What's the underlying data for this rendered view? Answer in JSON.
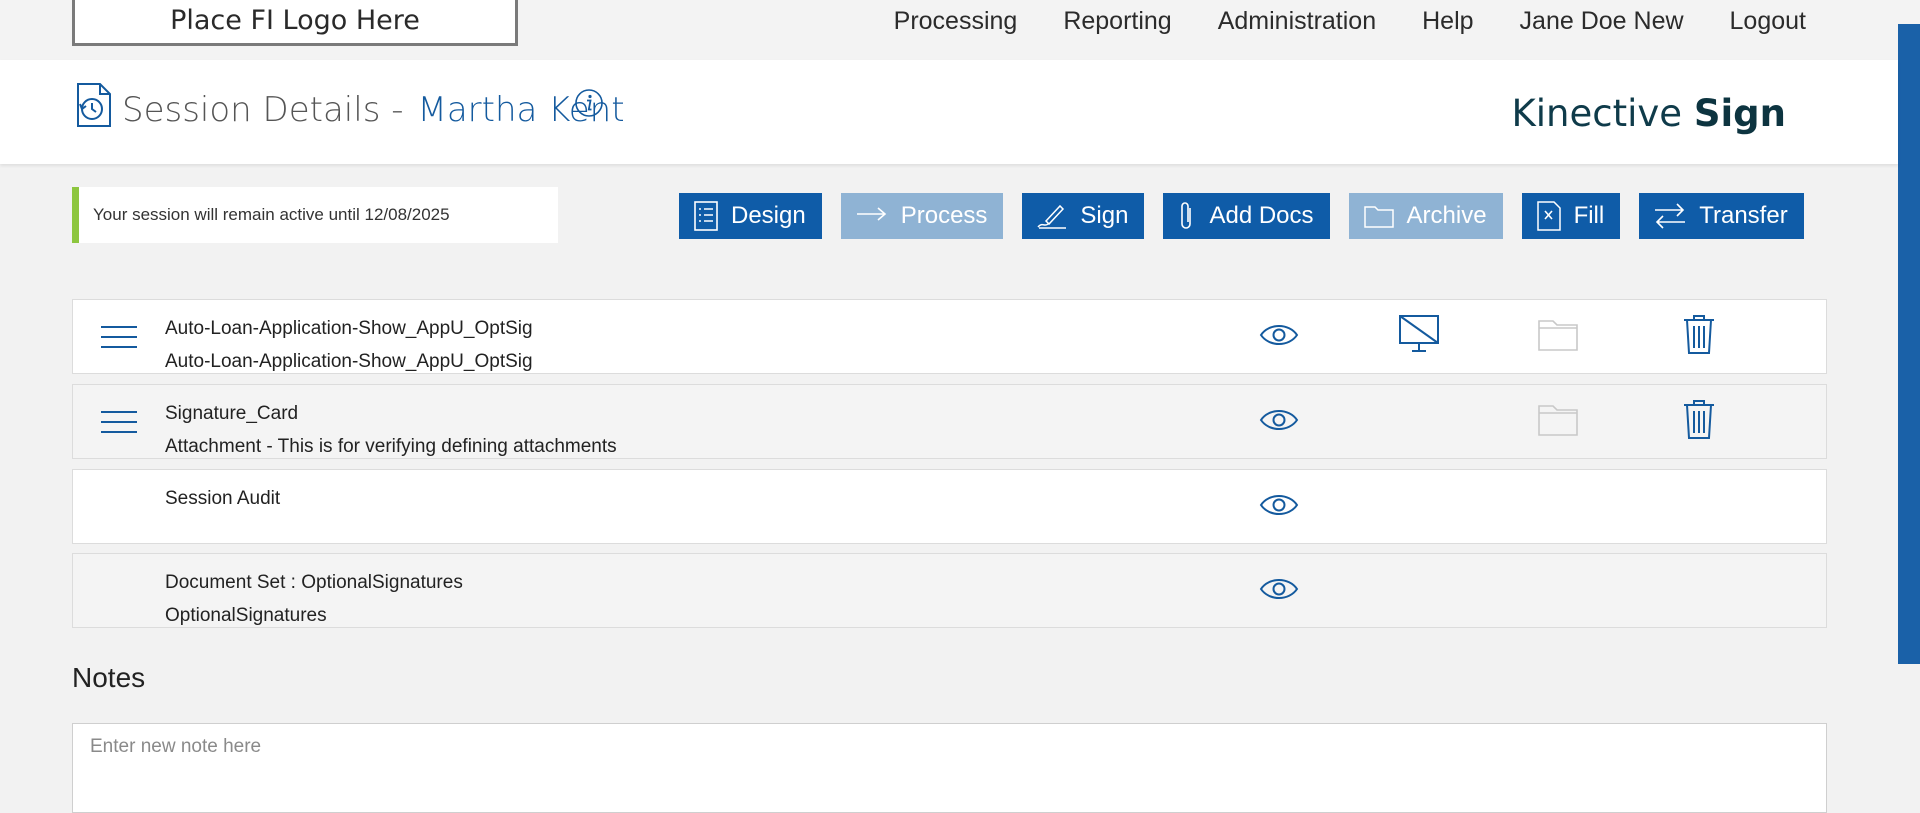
{
  "logo": {
    "text": "Place FI Logo Here"
  },
  "nav": {
    "processing": "Processing",
    "reporting": "Reporting",
    "administration": "Administration",
    "help": "Help",
    "user": "Jane Doe New",
    "logout": "Logout"
  },
  "header": {
    "title": "Session Details -",
    "customer": "Martha Kent",
    "brand_light": "Kinective",
    "brand_bold": "Sign"
  },
  "session": {
    "notice": "Your session will remain active until 12/08/2025"
  },
  "actions": {
    "design": "Design",
    "process": "Process",
    "sign": "Sign",
    "add_docs": "Add Docs",
    "archive": "Archive",
    "fill": "Fill",
    "transfer": "Transfer",
    "disabled": [
      "Process",
      "Archive"
    ]
  },
  "documents": [
    {
      "line1": "Auto-Loan-Application-Show_AppU_OptSig",
      "line2": "Auto-Loan-Application-Show_AppU_OptSig",
      "icons": [
        "drag-handle-icon",
        "eye-icon",
        "monitor-off-icon",
        "folder-icon",
        "trash-icon"
      ]
    },
    {
      "line1": "Signature_Card",
      "line2": "Attachment - This is for verifying defining attachments",
      "icons": [
        "drag-handle-icon",
        "eye-icon",
        "folder-icon",
        "trash-icon"
      ]
    },
    {
      "line1": "Session Audit",
      "line2": "",
      "icons": [
        "eye-icon"
      ]
    },
    {
      "line1": "Document Set : OptionalSignatures",
      "line2": "OptionalSignatures",
      "icons": [
        "eye-icon"
      ]
    }
  ],
  "notes": {
    "title": "Notes",
    "placeholder": "Enter new note here"
  },
  "colors": {
    "primary": "#0f5ca8",
    "disabled": "#8fb3d4",
    "accent_bar": "#8dc63f",
    "link": "#145a9e"
  }
}
